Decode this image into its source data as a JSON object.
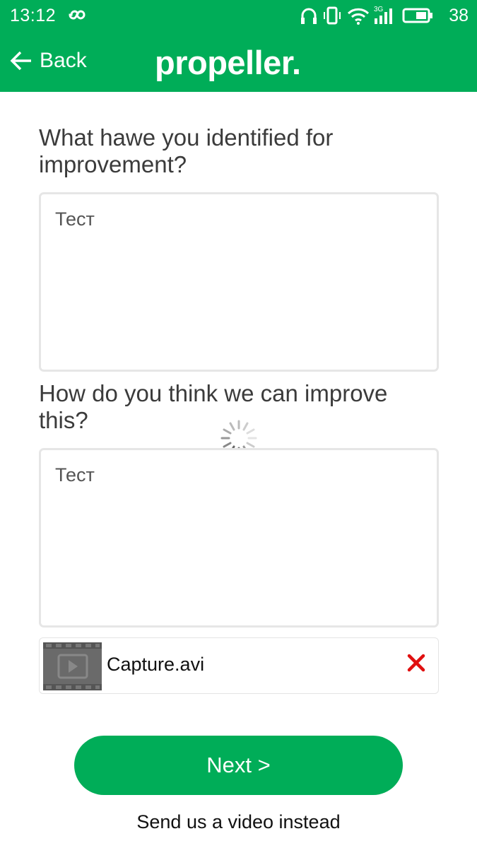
{
  "status_bar": {
    "time": "13:12",
    "battery_level": "38",
    "network": "3G",
    "icons": [
      "infinity-icon",
      "headphones-icon",
      "vibrate-icon",
      "wifi-icon",
      "signal-icon",
      "battery-icon"
    ]
  },
  "app_bar": {
    "back_label": "Back",
    "brand": "propeller.",
    "brand_color": "#00ad58"
  },
  "form": {
    "question1": "What hawe you identified for improvement?",
    "answer1": "Тест",
    "question2": "How do you think we can improve this?",
    "answer2": "Тест"
  },
  "attachment": {
    "file_name": "Capture.avi",
    "remove_icon": "close-icon",
    "remove_color": "#e01010"
  },
  "actions": {
    "next_label": "Next >",
    "video_link": "Send us a video instead"
  }
}
